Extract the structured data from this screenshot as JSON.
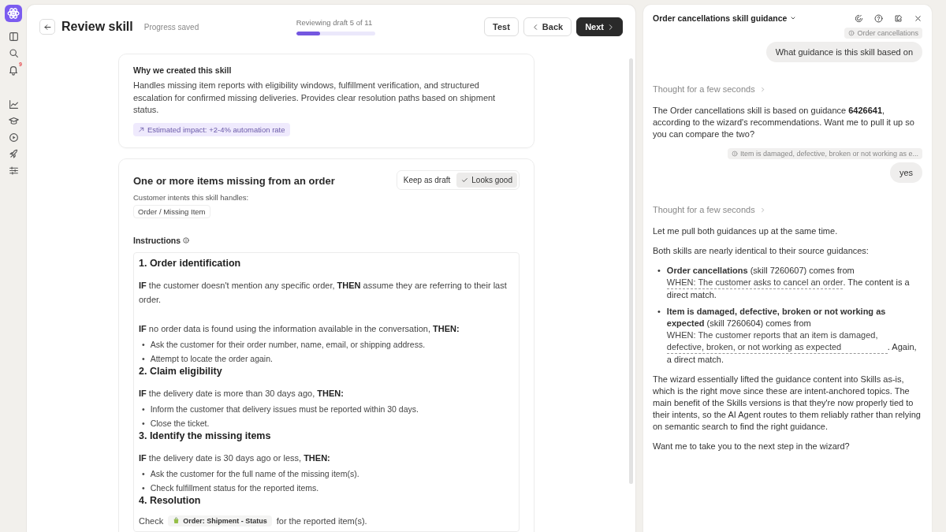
{
  "rail": {
    "notification_count": "9"
  },
  "header": {
    "title": "Review skill",
    "status": "Progress saved",
    "progress": {
      "label": "Reviewing draft 5 of 11",
      "level": 0.3
    },
    "buttons": [
      {
        "kind": "plain",
        "label": "Test"
      },
      {
        "kind": "back",
        "label": "Back"
      },
      {
        "kind": "primary",
        "label": "Next"
      }
    ]
  },
  "why_card": {
    "title": "Why we created this skill",
    "body": "Handles missing item reports with eligibility windows, fulfillment verification, and structured escalation for confirmed missing deliveries. Provides clear resolution paths based on shipment status.",
    "impact": "Estimated impact: +2-4% automation rate"
  },
  "skill_card": {
    "title": "One or more items missing from an order",
    "review_options": [
      {
        "label": "Keep as draft",
        "selected": false
      },
      {
        "label": "Looks good",
        "selected": true
      }
    ],
    "intents_label": "Customer intents this skill handles:",
    "intents": [
      "Order / Missing Item"
    ],
    "instructions_label": "Instructions",
    "sections": [
      {
        "heading": "1. Order identification",
        "blocks": [
          {
            "kind": "paragraph",
            "text": "**IF** the customer doesn't mention any specific order, **THEN** assume they are referring to their last order."
          },
          {
            "kind": "paragraph",
            "text": "**IF** no order data is found using the information available in the conversation, **THEN:**"
          },
          {
            "kind": "bullets",
            "marker": "•",
            "items": [
              "Ask the customer for their order number, name, email, or shipping address.",
              "Attempt to locate the order again."
            ]
          }
        ]
      },
      {
        "heading": "2. Claim eligibility",
        "blocks": [
          {
            "kind": "paragraph",
            "text": "**IF** the delivery date is more than 30 days ago, **THEN:**"
          },
          {
            "kind": "bullets",
            "marker": "•",
            "items": [
              "Inform the customer that delivery issues must be reported within 30 days.",
              "Close the ticket."
            ]
          }
        ]
      },
      {
        "heading": "3. Identify the missing items",
        "blocks": [
          {
            "kind": "paragraph",
            "text": "**IF** the delivery date is 30 days ago or less, **THEN:**"
          },
          {
            "kind": "bullets",
            "marker": "•",
            "items": [
              "Ask the customer for the full name of the missing item(s).",
              "Check fulfillment status for the reported items."
            ]
          }
        ]
      },
      {
        "heading": "4. Resolution",
        "blocks": [
          {
            "kind": "field_check",
            "before": "Check",
            "field": "Order: Shipment - Status",
            "after": "for the reported item(s)."
          }
        ]
      }
    ]
  },
  "chat": {
    "title": "Order cancellations skill guidance",
    "messages": [
      {
        "kind": "context",
        "text": "Order cancellations"
      },
      {
        "kind": "user",
        "text": "What guidance is this skill based on"
      },
      {
        "kind": "thought",
        "text": "Thought for a few seconds"
      },
      {
        "kind": "assistant",
        "text": "The Order cancellations skill is based on guidance **6426641**, according to the wizard's recommendations. Want me to pull it up so you can compare the two?"
      },
      {
        "kind": "context",
        "text": "Item is damaged, defective, broken or not working as e..."
      },
      {
        "kind": "user",
        "text": "yes"
      },
      {
        "kind": "thought",
        "text": "Thought for a few seconds"
      },
      {
        "kind": "assistant",
        "text": "Let me pull both guidances up at the same time."
      },
      {
        "kind": "assistant",
        "text": "Both skills are nearly identical to their source guidances:"
      },
      {
        "kind": "sources",
        "marker": "•",
        "items": [
          {
            "name": "Order cancellations",
            "detail": "(skill 7260607) comes from",
            "link": "WHEN: The customer asks to cancel an order",
            "tail": ". The content is a direct match."
          },
          {
            "name": "Item is damaged, defective, broken or not working as expected",
            "detail": "(skill 7260604) comes from",
            "link": "WHEN: The customer reports that an item is damaged, defective, broken, or not working as expected",
            "tail": ". Again, a direct match."
          }
        ]
      },
      {
        "kind": "assistant",
        "text": "The wizard essentially lifted the guidance content into Skills as-is, which is the right move since these are intent-anchored topics. The main benefit of the Skills versions is that they're now properly tied to their intents, so the AI Agent routes to them reliably rather than relying on semantic search to find the right guidance."
      },
      {
        "kind": "assistant",
        "text": "Want me to take you to the next step in the wizard?"
      }
    ]
  }
}
